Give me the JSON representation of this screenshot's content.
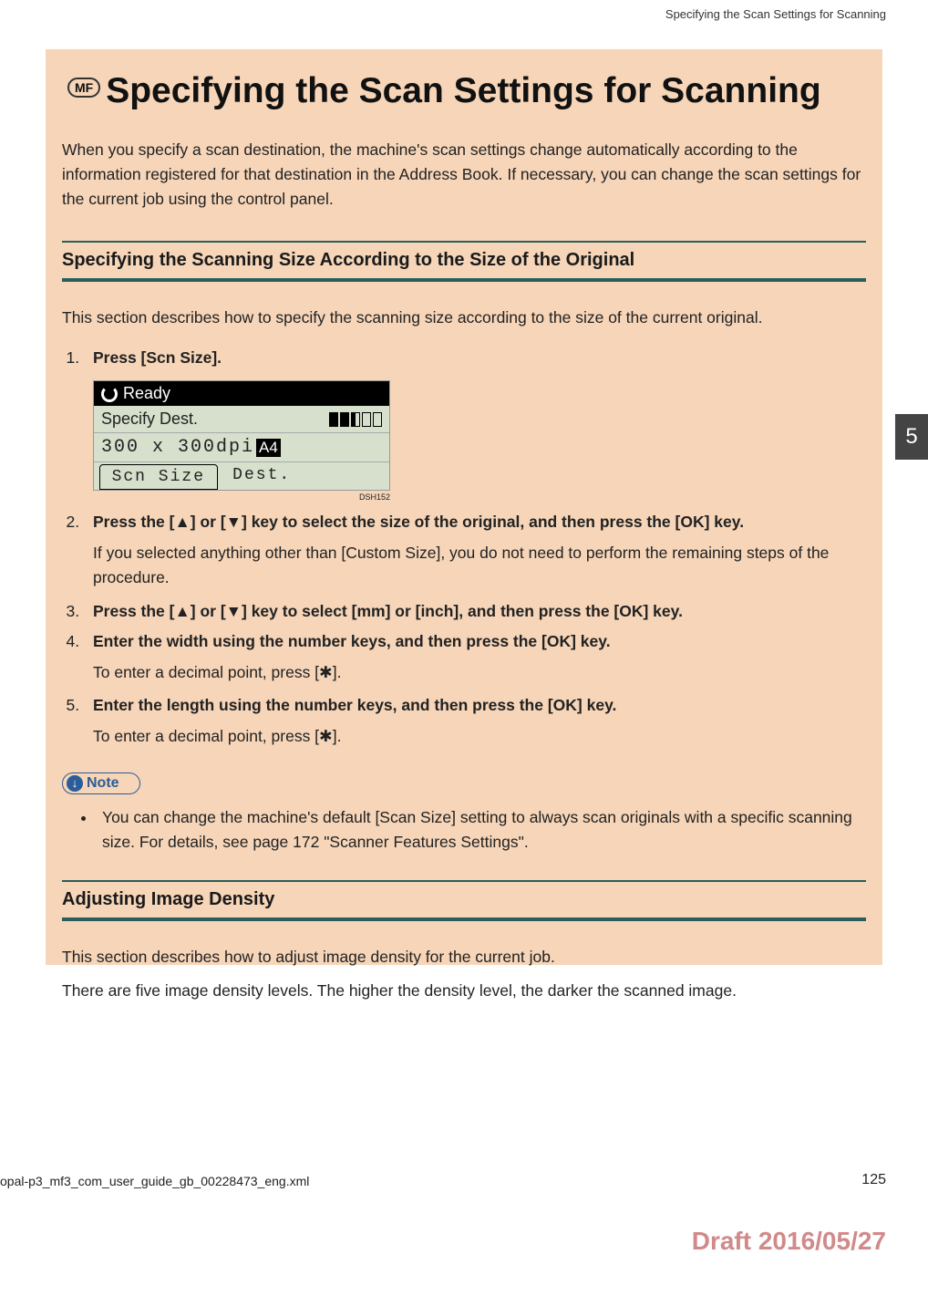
{
  "running_header": "Specifying the Scan Settings for Scanning",
  "mf_label": "MF",
  "page_title": "Specifying the Scan Settings for Scanning",
  "intro": "When you specify a scan destination, the machine's scan settings change automatically according to the information registered for that destination in the Address Book. If necessary, you can change the scan settings for the current job using the control panel.",
  "section1": {
    "heading": "Specifying the Scanning Size According to the Size of the Original",
    "desc": "This section describes how to specify the scanning size according to the size of the current original."
  },
  "steps": {
    "s1_main": "Press [Scn Size].",
    "s2_main": "Press the [▲] or [▼] key to select the size of the original, and then press the [OK] key.",
    "s2_sub": "If you selected anything other than [Custom Size], you do not need to perform the remaining steps of the procedure.",
    "s3_main": "Press the [▲] or [▼] key to select [mm] or [inch], and then press the [OK] key.",
    "s4_main": "Enter the width using the number keys, and then press the [OK] key.",
    "s4_sub_pre": "To enter a decimal point, press [",
    "s4_sub_post": "].",
    "s5_main": "Enter the length using the number keys, and then press the [OK] key.",
    "s5_sub_pre": "To enter a decimal point, press [",
    "s5_sub_post": "]."
  },
  "star_glyph": "✱",
  "lcd": {
    "ready": "Ready",
    "specify": "Specify Dest.",
    "dpi": "300 x 300dpi",
    "a4": "A4",
    "scn_size": "Scn Size",
    "dest": "Dest.",
    "code": "DSH152"
  },
  "note_label": "Note",
  "note_item": "You can change the machine's default [Scan Size] setting to always scan originals with a specific scanning size. For details, see page 172 \"Scanner Features Settings\".",
  "section2": {
    "heading": "Adjusting Image Density",
    "desc1": "This section describes how to adjust image density for the current job.",
    "desc2": "There are five image density levels. The higher the density level, the darker the scanned image."
  },
  "chapter": "5",
  "footer_file": "opal-p3_mf3_com_user_guide_gb_00228473_eng.xml",
  "page_number": "125",
  "draft": "Draft 2016/05/27"
}
